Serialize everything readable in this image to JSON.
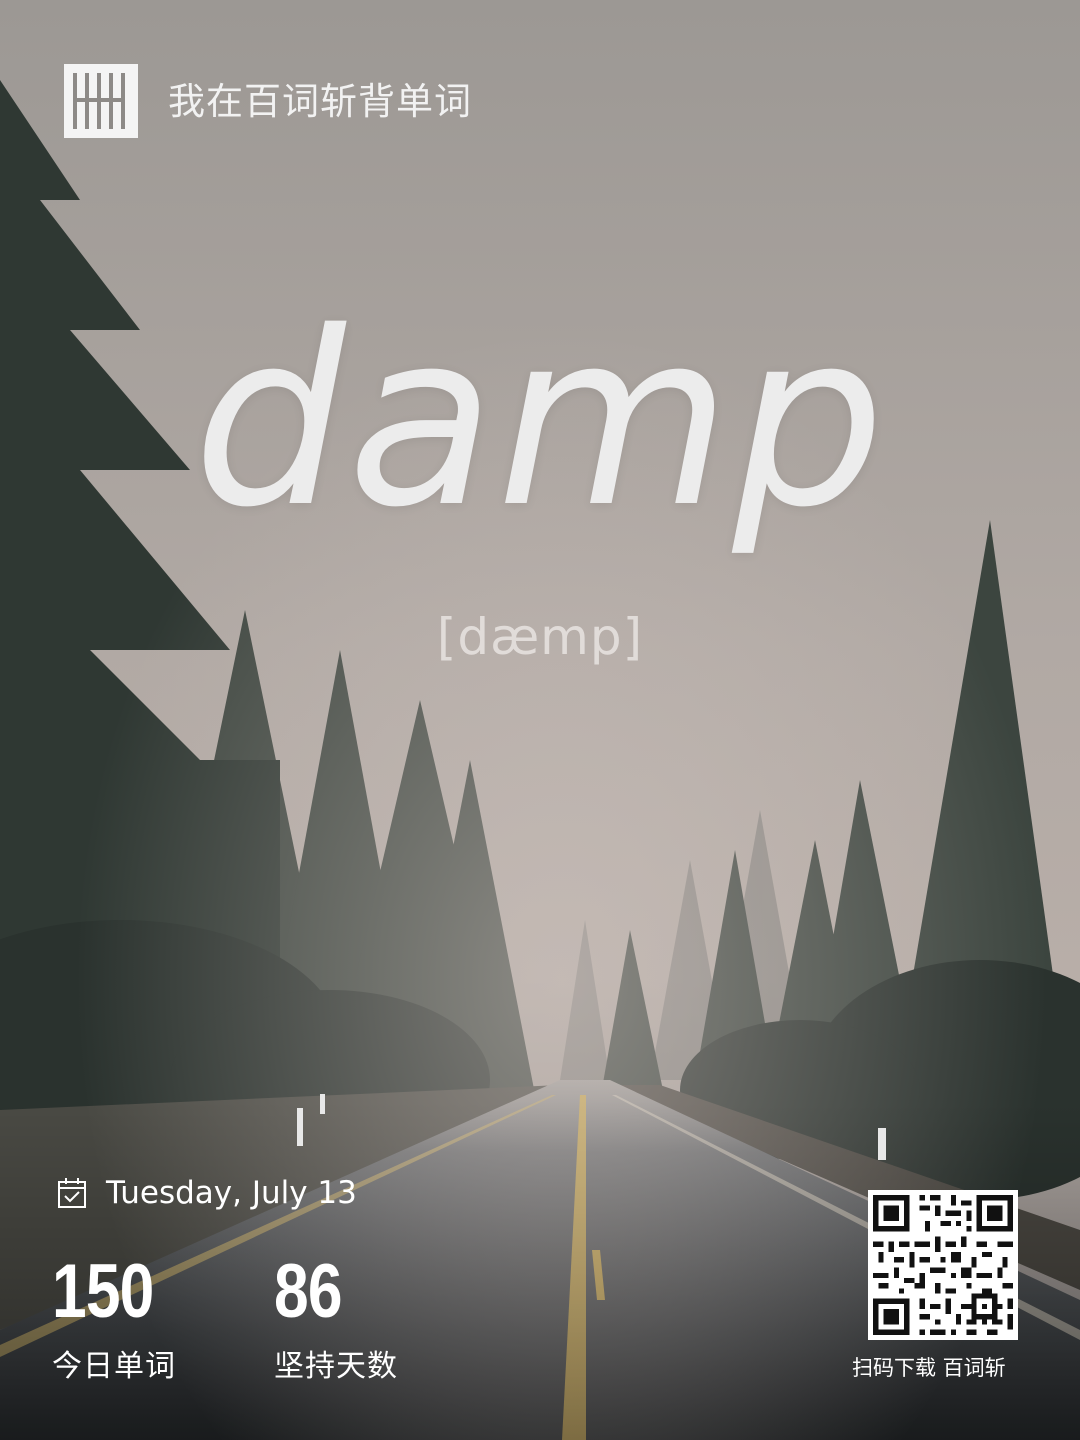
{
  "header": {
    "app_tagline": "我在百词斩背单词",
    "logo": "baicizhan-100-logo-icon"
  },
  "card": {
    "word": "damp",
    "phonetic": "[dæmp]"
  },
  "footer": {
    "date": "Tuesday,  July 13",
    "today_words_value": "150",
    "today_words_label": "今日单词",
    "streak_days_value": "86",
    "streak_days_label": "坚持天数",
    "qr_caption": "扫码下载  百词斩"
  },
  "colors": {
    "sky_top": "#9f9b97",
    "sky_bottom": "#b5aca7",
    "forest_dark": "#2e3531",
    "road": "#3d4144",
    "road_line_yellow": "#d7b04e",
    "text_white": "#ffffff"
  }
}
